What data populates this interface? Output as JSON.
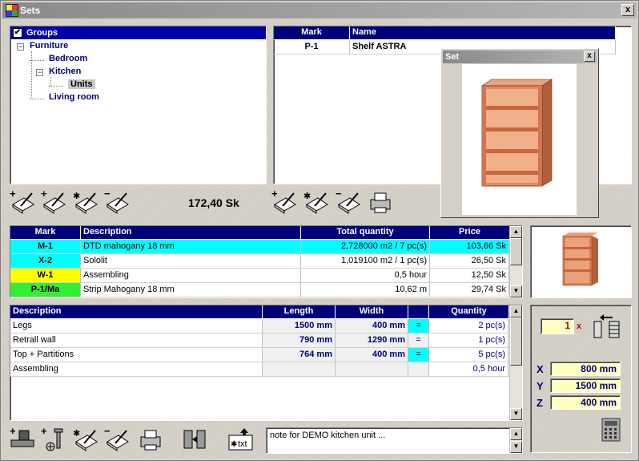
{
  "window": {
    "title": "Sets",
    "close_label": "x"
  },
  "groups": {
    "header": "Groups",
    "tree": [
      {
        "label": "Furniture",
        "level": 0,
        "expander": "−"
      },
      {
        "label": "Bedroom",
        "level": 1
      },
      {
        "label": "Kitchen",
        "level": 1,
        "expander": "−"
      },
      {
        "label": "Units",
        "level": 2,
        "selected": true
      },
      {
        "label": "Living room",
        "level": 1
      }
    ]
  },
  "sets_list": {
    "columns": [
      "Mark",
      "Name"
    ],
    "rows": [
      {
        "mark": "P-1",
        "name": "Shelf ASTRA"
      }
    ]
  },
  "set_popup": {
    "title": "Set",
    "close_label": "x"
  },
  "total_price": "172,40 Sk",
  "materials": {
    "columns": [
      "Mark",
      "Description",
      "Total quantity",
      "Price"
    ],
    "rows": [
      {
        "mark": "M-1",
        "description": "DTD mahogany 18 mm",
        "quantity": "2,728000 m2 / 7 pc(s)",
        "price": "103,66 Sk",
        "mark_color": "cyan",
        "row_color": "cyan"
      },
      {
        "mark": "X-2",
        "description": "Sololit",
        "quantity": "1,019100 m2 / 1 pc(s)",
        "price": "26,50 Sk",
        "mark_color": "cyan",
        "row_color": ""
      },
      {
        "mark": "W-1",
        "description": "Assembling",
        "quantity": "0,5 hour",
        "price": "12,50 Sk",
        "mark_color": "yellow",
        "row_color": ""
      },
      {
        "mark": "P-1/Ma",
        "description": "Strip Mahogany 18 mm",
        "quantity": "10,62 m",
        "price": "29,74 Sk",
        "mark_color": "green",
        "row_color": ""
      }
    ]
  },
  "parts": {
    "columns": [
      "Description",
      "Length",
      "Width",
      "",
      "Quantity"
    ],
    "rows": [
      {
        "description": "Legs",
        "length": "1500 mm",
        "width": "400 mm",
        "eq": "=",
        "eq_hl": true,
        "quantity": "2 pc(s)"
      },
      {
        "description": "Retrall wall",
        "length": "790 mm",
        "width": "1290 mm",
        "eq": "=",
        "eq_hl": false,
        "quantity": "1 pc(s)"
      },
      {
        "description": "Top + Partitions",
        "length": "764 mm",
        "width": "400 mm",
        "eq": "=",
        "eq_hl": true,
        "quantity": "5 pc(s)"
      },
      {
        "description": "Assembling",
        "length": "",
        "width": "",
        "eq": "",
        "eq_hl": false,
        "quantity": "0,5 hour"
      }
    ]
  },
  "multiplier": {
    "value": "1",
    "suffix": "x"
  },
  "dimensions": {
    "x_label": "X",
    "x_value": "800 mm",
    "y_label": "Y",
    "y_value": "1500 mm",
    "z_label": "Z",
    "z_value": "400 mm"
  },
  "note": "note for DEMO kitchen unit ...",
  "toolbar_txt_label": "txt",
  "colors": {
    "cyan": "#00ffff",
    "yellow": "#ffff00",
    "green": "#33ee33",
    "header_blue": "#0000a8",
    "wood": "#d9805a"
  }
}
